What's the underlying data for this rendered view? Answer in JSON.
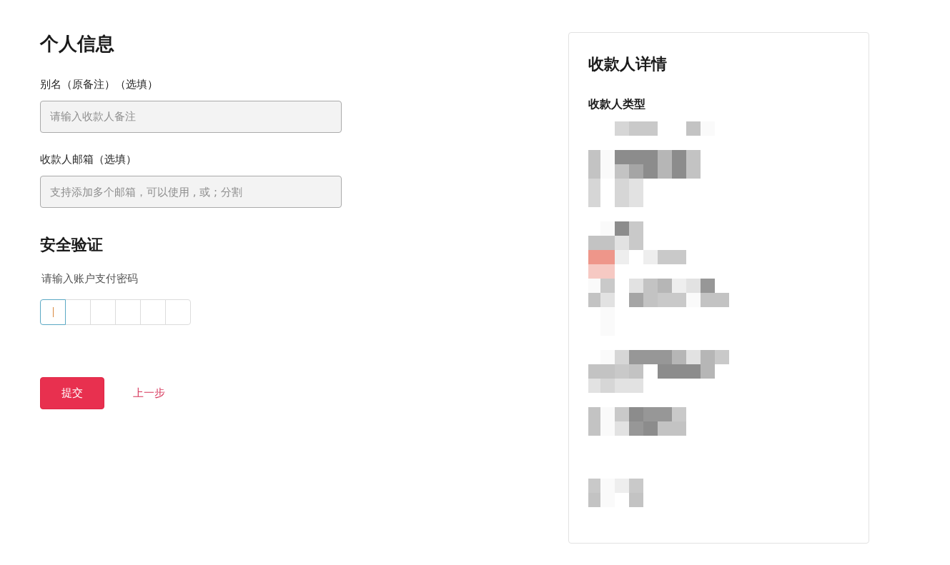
{
  "personal_info": {
    "title": "个人信息",
    "fields": [
      {
        "label": "别名（原备注）（选填）",
        "placeholder": "请输入收款人备注"
      },
      {
        "label": "收款人邮箱（选填）",
        "placeholder": "支持添加多个邮箱，可以使用 , 或 ; 分割"
      }
    ]
  },
  "security": {
    "title": "安全验证",
    "hint": "请输入账户支付密码",
    "pin_cells": [
      {
        "focused": true
      },
      {
        "focused": false
      },
      {
        "focused": false
      },
      {
        "focused": false
      },
      {
        "focused": false
      },
      {
        "focused": false
      }
    ]
  },
  "actions": {
    "submit": "提交",
    "back": "上一步"
  },
  "payee_details": {
    "title": "收款人详情",
    "sections": [
      {
        "heading": "收款人类型"
      }
    ]
  }
}
